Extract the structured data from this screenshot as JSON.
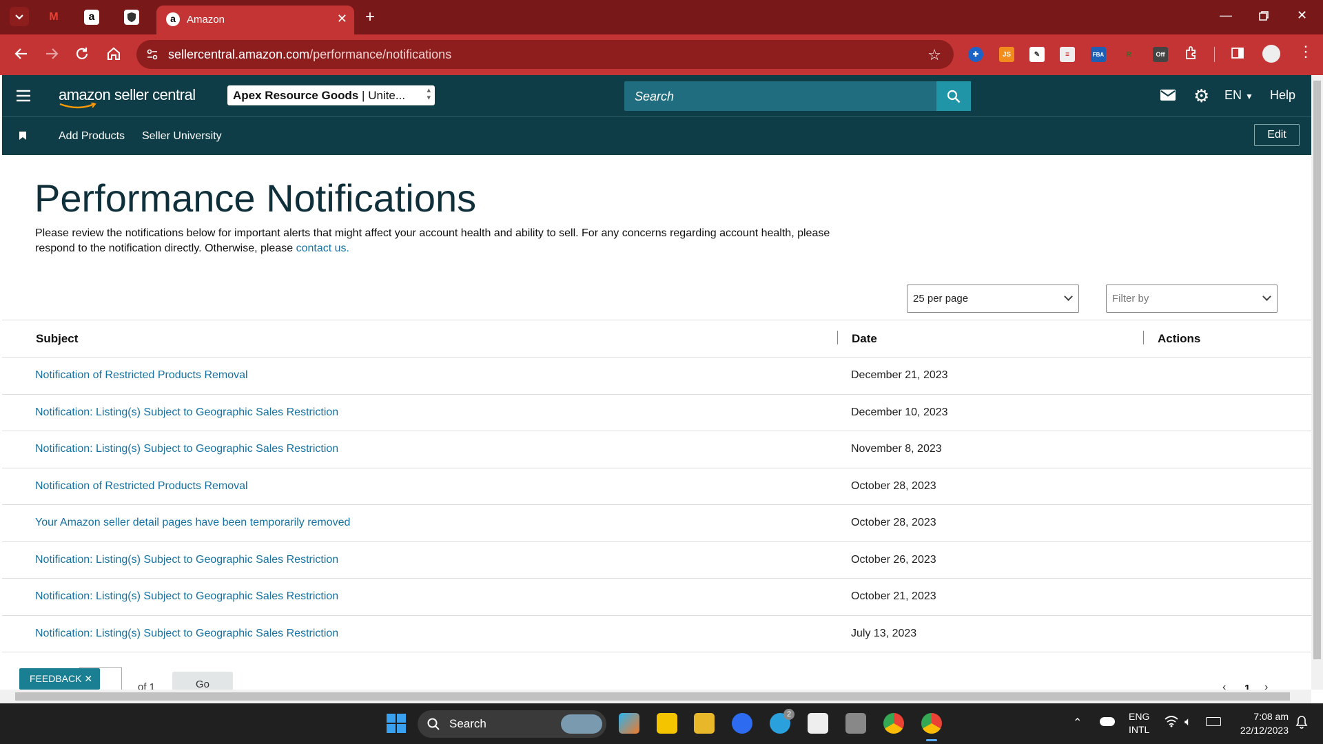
{
  "browser": {
    "active_tab": {
      "title": "Amazon"
    },
    "pinned_tabs": [
      "gmail-icon",
      "amazon-icon",
      "shield-icon"
    ],
    "url": {
      "domain": "sellercentral.amazon.com",
      "path": "/performance/notifications"
    },
    "extensions": [
      "JS",
      "FBA",
      "Off"
    ]
  },
  "header": {
    "logo": "amazon seller central",
    "store": {
      "name": "Apex Resource Goods",
      "region": "Unite..."
    },
    "search_placeholder": "Search",
    "language": "EN",
    "help": "Help"
  },
  "subnav": {
    "links": [
      "Add Products",
      "Seller University"
    ],
    "edit": "Edit"
  },
  "page": {
    "title": "Performance Notifications",
    "description": "Please review the notifications below for important alerts that might affect your account health and ability to sell. For any concerns regarding account health, please respond to the notification directly. Otherwise, please ",
    "contact_link": "contact us.",
    "per_page": "25 per page",
    "filter_placeholder": "Filter by"
  },
  "table": {
    "columns": [
      "Subject",
      "Date",
      "Actions"
    ],
    "rows": [
      {
        "subject": "Notification of Restricted Products Removal",
        "date": "December 21, 2023"
      },
      {
        "subject": "Notification: Listing(s) Subject to Geographic Sales Restriction",
        "date": "December 10, 2023"
      },
      {
        "subject": "Notification: Listing(s) Subject to Geographic Sales Restriction",
        "date": "November 8, 2023"
      },
      {
        "subject": "Notification of Restricted Products Removal",
        "date": "October 28, 2023"
      },
      {
        "subject": "Your Amazon seller detail pages have been temporarily removed",
        "date": "October 28, 2023"
      },
      {
        "subject": "Notification: Listing(s) Subject to Geographic Sales Restriction",
        "date": "October 26, 2023"
      },
      {
        "subject": "Notification: Listing(s) Subject to Geographic Sales Restriction",
        "date": "October 21, 2023"
      },
      {
        "subject": "Notification: Listing(s) Subject to Geographic Sales Restriction",
        "date": "July 13, 2023"
      }
    ]
  },
  "pagination": {
    "of_label": "of 1",
    "go": "Go",
    "current": "1"
  },
  "feedback": "FEEDBACK ✕",
  "taskbar": {
    "search": "Search",
    "telegram_badge": "2",
    "lang_top": "ENG",
    "lang_bottom": "INTL",
    "time": "7:08 am",
    "date": "22/12/2023"
  }
}
